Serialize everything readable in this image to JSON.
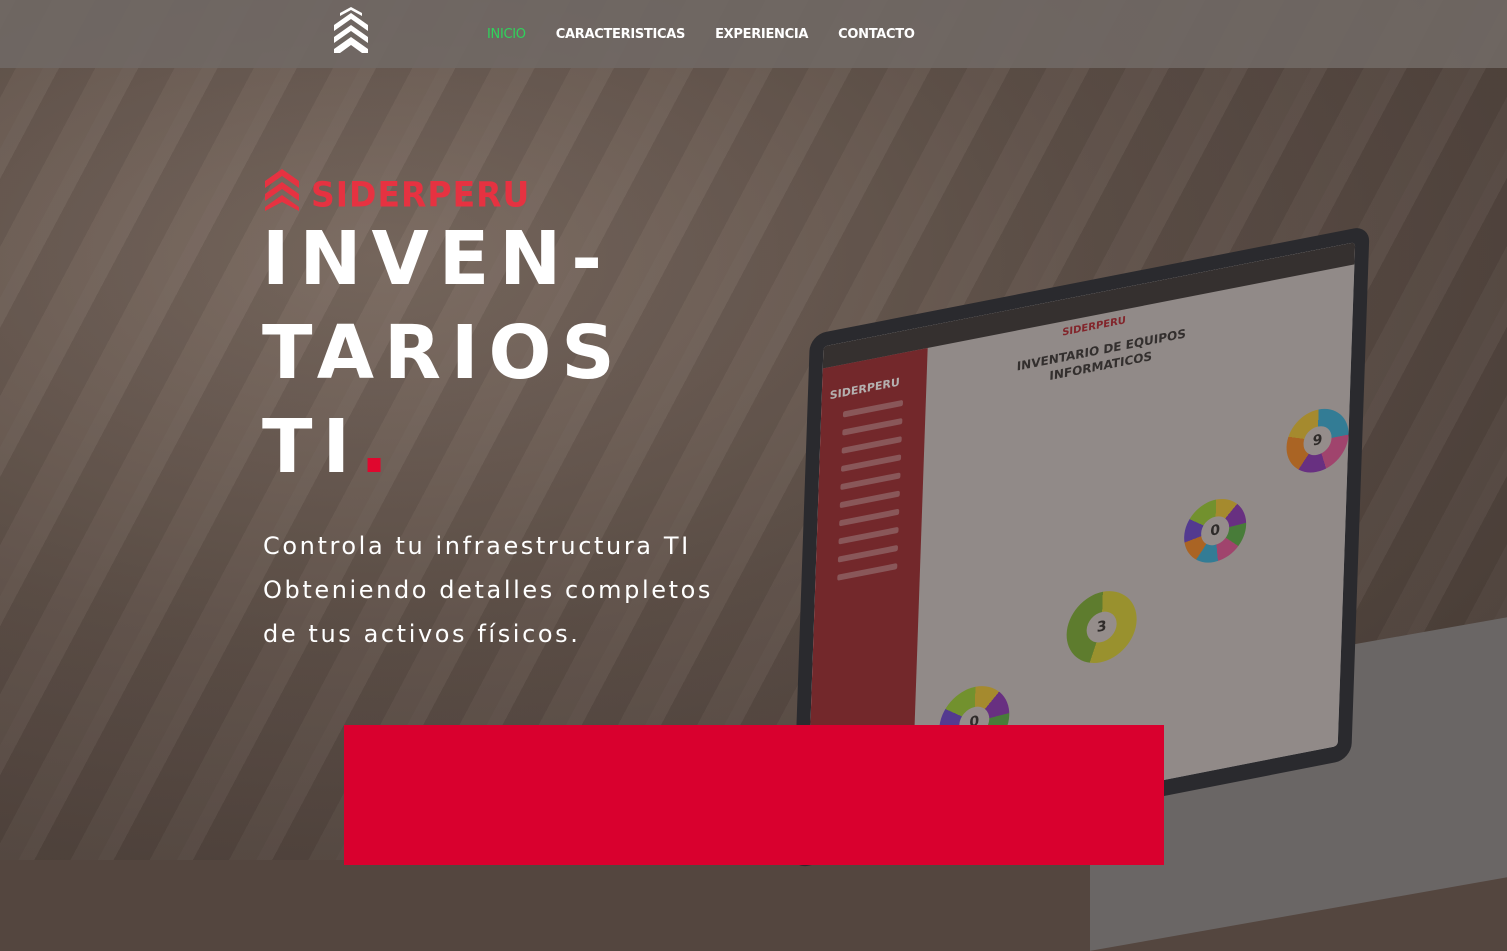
{
  "nav": {
    "items": [
      {
        "label": "INICIO",
        "active": true
      },
      {
        "label": "CARACTERISTICAS",
        "active": false
      },
      {
        "label": "EXPERIENCIA",
        "active": false
      },
      {
        "label": "CONTACTO",
        "active": false
      }
    ],
    "active_color": "#2fd35c"
  },
  "hero": {
    "brand": "SIDERPERU",
    "brand_color": "#e63241",
    "headline_lines": [
      "INVEN-",
      "TARIOS",
      "TI"
    ],
    "headline_dot": ".",
    "subtext_lines": [
      "Controla tu infraestructura TI",
      "Obteniendo detalles completos",
      "de tus activos físicos."
    ],
    "accent_color": "#d9002e"
  },
  "laptop_screen": {
    "brand": "SIDERPERU",
    "sidebar_brand": "SIDERPERU",
    "title": "INVENTARIO DE EQUIPOS INFORMATICOS",
    "donut_values": [
      "0",
      "3",
      "0",
      "9"
    ]
  },
  "icons": {
    "brand_mark": "chevron-stack-icon",
    "logo_icon": "chevron-stack-icon"
  }
}
